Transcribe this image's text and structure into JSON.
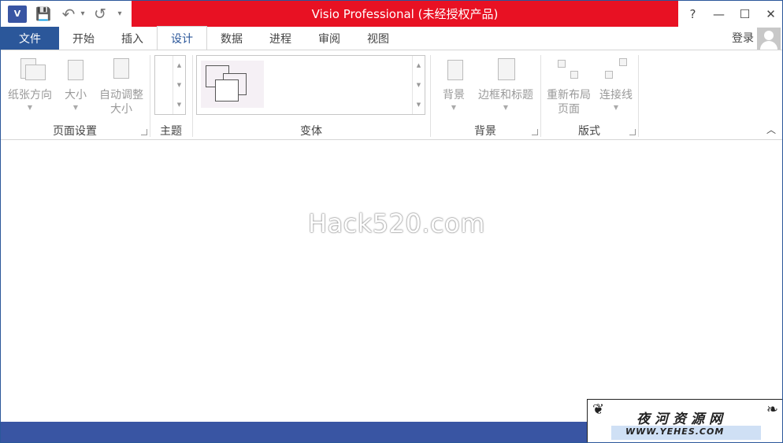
{
  "window": {
    "title": "Visio Professional (未经授权产品)",
    "app_icon_text": "V",
    "help": "?",
    "minimize": "—",
    "maximize": "☐",
    "close": "✕"
  },
  "qat": {
    "save": "💾",
    "undo": "↶",
    "undo_drop": "▾",
    "redo": "↺",
    "customize": "▾"
  },
  "tabs": [
    {
      "label": "文件"
    },
    {
      "label": "开始"
    },
    {
      "label": "插入"
    },
    {
      "label": "设计"
    },
    {
      "label": "数据"
    },
    {
      "label": "进程"
    },
    {
      "label": "审阅"
    },
    {
      "label": "视图"
    }
  ],
  "account": {
    "login": "登录"
  },
  "ribbon": {
    "page_setup": {
      "group_label": "页面设置",
      "orientation": "纸张方向",
      "size": "大小",
      "auto_size_1": "自动调整",
      "auto_size_2": "大小"
    },
    "themes": {
      "group_label": "主题"
    },
    "variants": {
      "group_label": "变体"
    },
    "backgrounds": {
      "group_label": "背景",
      "background": "背景",
      "borders_titles": "边框和标题"
    },
    "layout": {
      "group_label": "版式",
      "relayout_1": "重新布局",
      "relayout_2": "页面",
      "connectors": "连接线"
    }
  },
  "canvas": {
    "watermark": "Hack520.com"
  },
  "badge": {
    "name": "夜河资源网",
    "url": "WWW.YEHES.COM"
  },
  "colors": {
    "accent": "#2b579a",
    "title_bar": "#e81123",
    "status_bar": "#3955a3"
  }
}
